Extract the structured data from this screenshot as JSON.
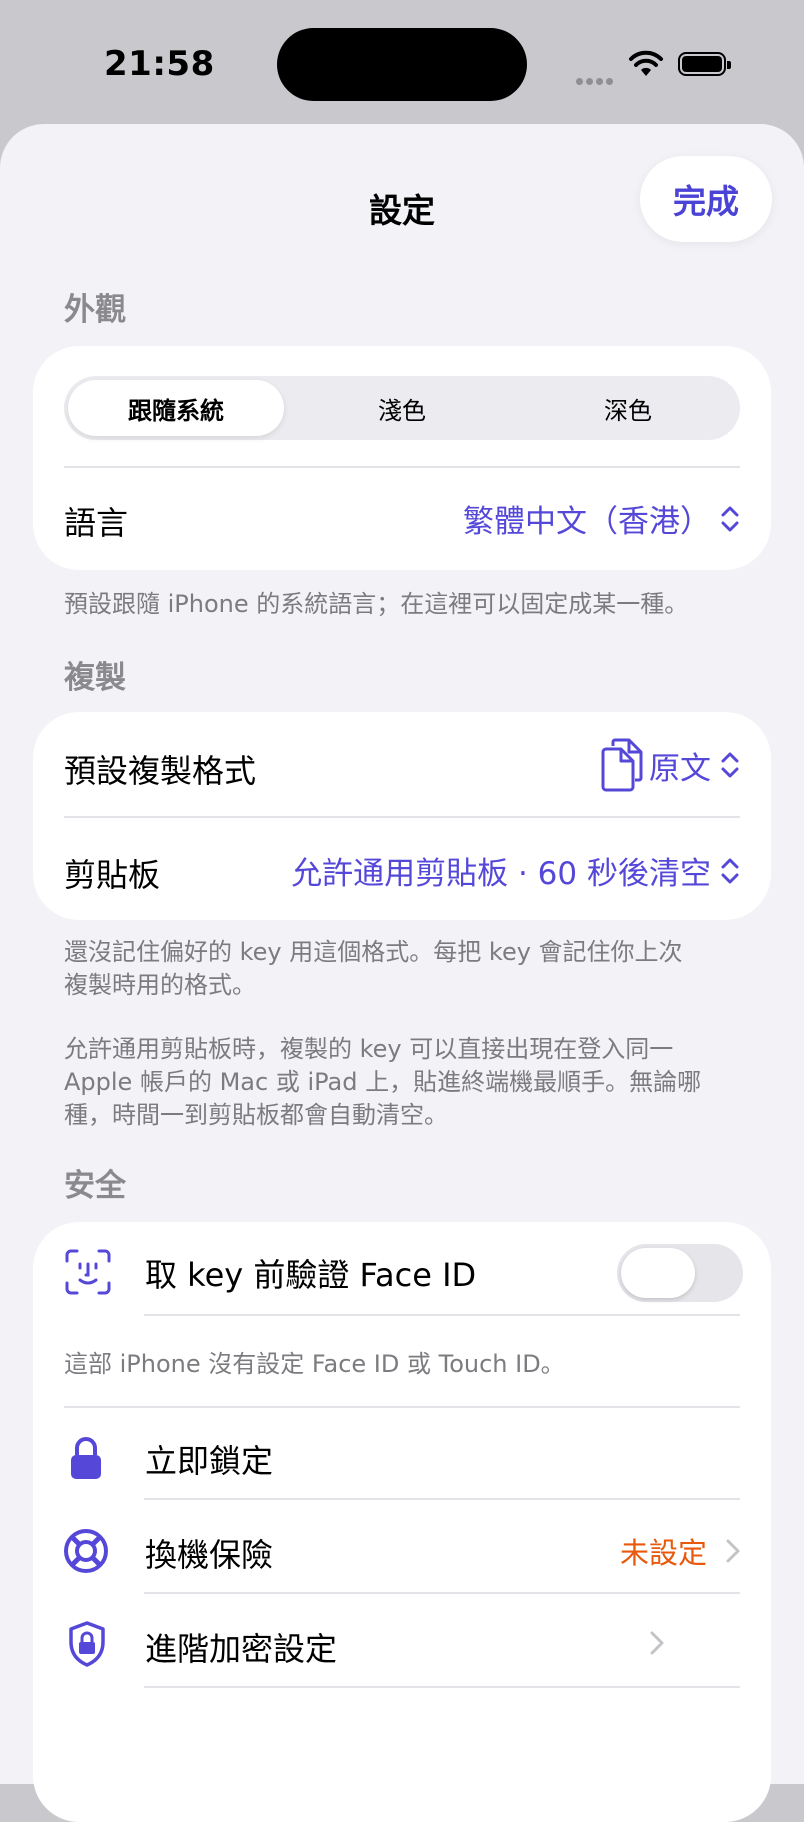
{
  "status_bar": {
    "time": "21:58"
  },
  "nav": {
    "title": "設定",
    "done_label": "完成"
  },
  "appearance": {
    "header": "外觀",
    "segments": [
      "跟隨系統",
      "淺色",
      "深色"
    ],
    "selected_index": 0,
    "language_label": "語言",
    "language_value": "繁體中文（香港）",
    "footnote": "預設跟隨 iPhone 的系統語言；在這裡可以固定成某一種。"
  },
  "copy": {
    "header": "複製",
    "format_label": "預設複製格式",
    "format_value": "原文",
    "clipboard_label": "剪貼板",
    "clipboard_value": "允許通用剪貼板 · 60 秒後清空",
    "footnote1_line1": "還沒記住偏好的 key 用這個格式。每把 key 會記住你上次",
    "footnote1_line2": "複製時用的格式。",
    "footnote2_line1": "允許通用剪貼板時，複製的 key 可以直接出現在登入同一",
    "footnote2_line2": "Apple 帳戶的 Mac 或 iPad 上，貼進終端機最順手。無論哪",
    "footnote2_line3": "種，時間一到剪貼板都會自動清空。"
  },
  "security": {
    "header": "安全",
    "faceid_label": "取 key 前驗證 Face ID",
    "faceid_enabled": false,
    "faceid_note": "這部 iPhone 沒有設定 Face ID 或 Touch ID。",
    "lock_label": "立即鎖定",
    "migration_label": "換機保險",
    "migration_value": "未設定",
    "encryption_label": "進階加密設定"
  },
  "colors": {
    "accent": "#5548d9",
    "warning": "#e8590c",
    "background": "#f2f2f7"
  },
  "icons": [
    "face-id-icon",
    "lock-icon",
    "lifebuoy-icon",
    "shield-lock-icon",
    "copy-doc-icon",
    "chevron-updown-icon",
    "chevron-right-icon"
  ]
}
